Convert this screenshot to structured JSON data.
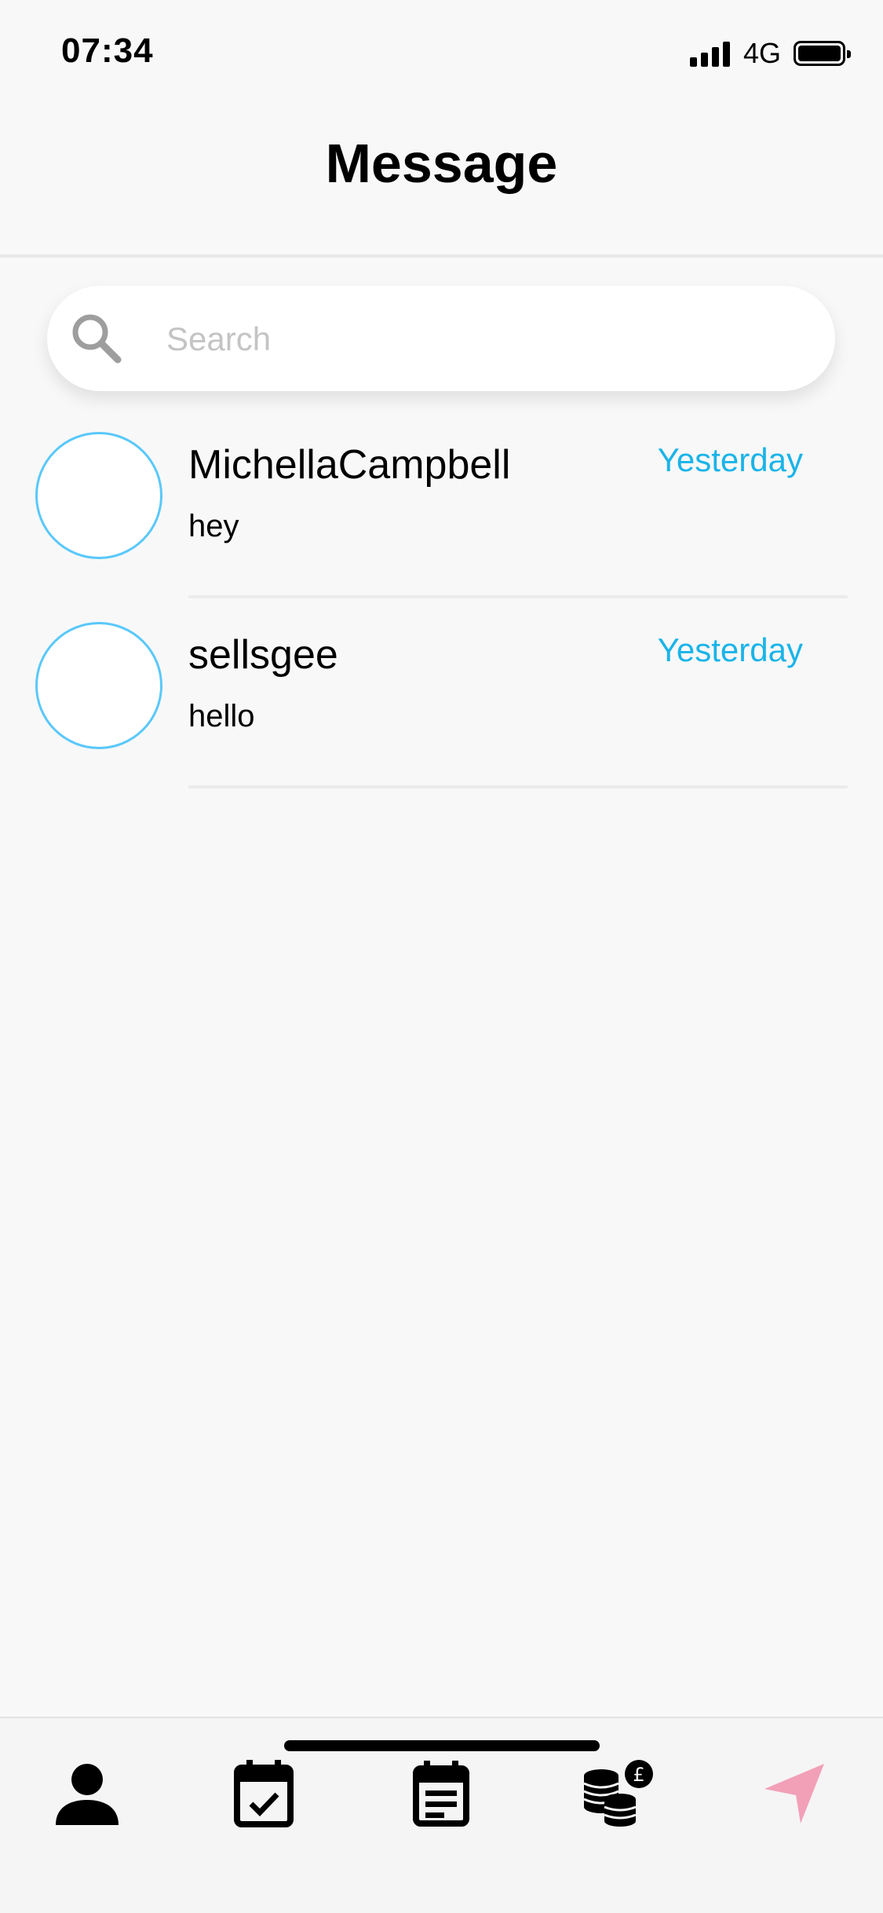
{
  "status_bar": {
    "time": "07:34",
    "network": "4G"
  },
  "header": {
    "title": "Message"
  },
  "search": {
    "placeholder": "Search",
    "value": ""
  },
  "conversations": [
    {
      "name": "MichellaCampbell",
      "preview": "hey",
      "time": "Yesterday"
    },
    {
      "name": "sellsgee",
      "preview": "hello",
      "time": "Yesterday"
    }
  ],
  "tab_bar": {
    "tabs": [
      {
        "icon": "profile-icon",
        "active": false
      },
      {
        "icon": "calendar-check-icon",
        "active": false
      },
      {
        "icon": "calendar-notes-icon",
        "active": false
      },
      {
        "icon": "coins-pound-icon",
        "active": false
      },
      {
        "icon": "send-icon",
        "active": true
      }
    ],
    "active_color": "#f2a0b8",
    "inactive_color": "#000000"
  },
  "colors": {
    "accent": "#1ab4e8",
    "avatar_border": "#5ac8fa",
    "background": "#f8f8f8"
  }
}
